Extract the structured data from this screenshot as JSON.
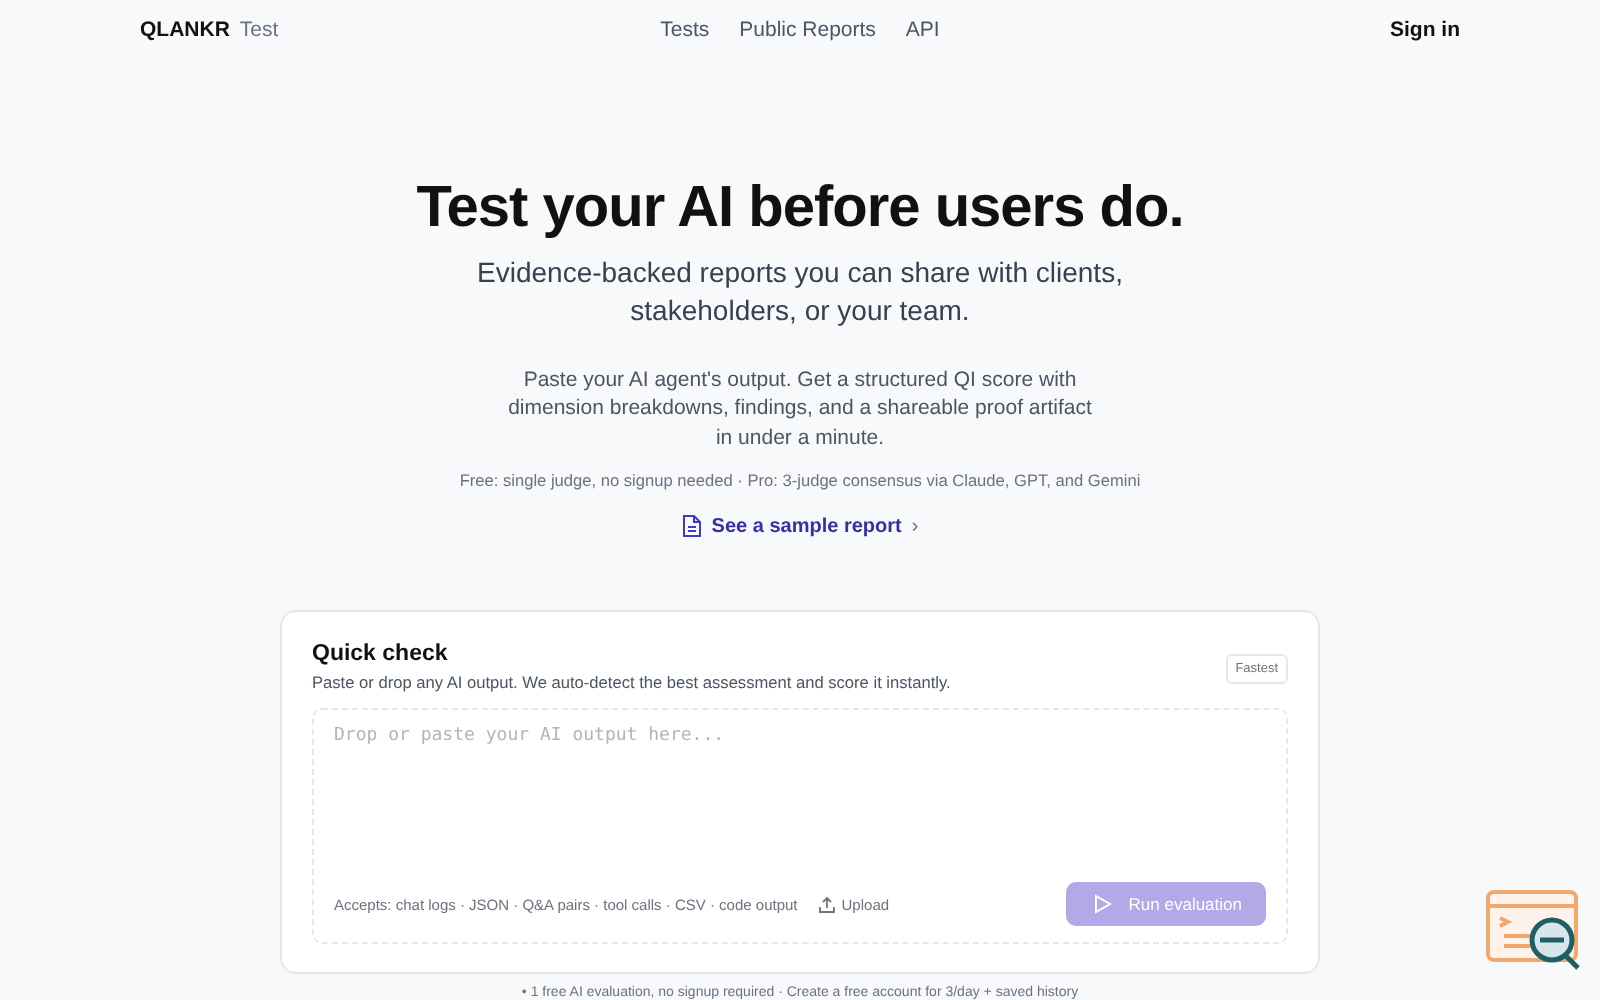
{
  "nav": {
    "brand": "QLANKR",
    "brand_suffix": "Test",
    "links": [
      "Tests",
      "Public Reports",
      "API"
    ],
    "sign_in": "Sign in"
  },
  "hero": {
    "title": "Test your AI before users do.",
    "subtitle": "Evidence-backed reports you can share with clients, stakeholders, or your team.",
    "description": "Paste your AI agent's output. Get a structured QI score with dimension breakdowns, findings, and a shareable proof artifact in under a minute.",
    "tiers": "Free: single judge, no signup needed · Pro: 3-judge consensus via Claude, GPT, and Gemini",
    "sample_link": "See a sample report",
    "sample_chevron": "›"
  },
  "quick_check": {
    "title": "Quick check",
    "subtitle": "Paste or drop any AI output. We auto-detect the best assessment and score it instantly.",
    "badge": "Fastest",
    "input": {
      "placeholder": "Drop or paste your AI output here..."
    },
    "accepts": "Accepts: chat logs · JSON · Q&A pairs · tool calls · CSV · code output",
    "upload": "Upload",
    "run_button": {
      "label": "Run evaluation",
      "disabled": true
    }
  },
  "footnote": "• 1 free AI evaluation, no signup required · Create a free account for 3/day + saved history"
}
